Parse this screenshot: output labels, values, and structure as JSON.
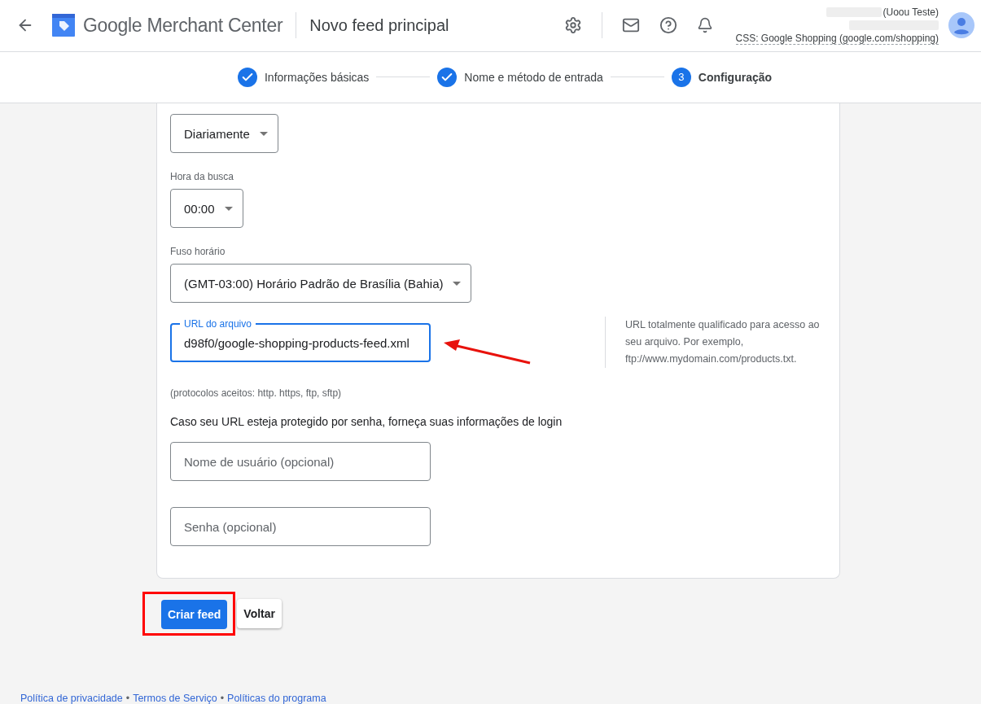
{
  "header": {
    "brand": "Google Merchant Center",
    "page_title": "Novo feed principal",
    "account": {
      "name": "(Uoou Teste)",
      "css": "CSS: Google Shopping (google.com/shopping)"
    }
  },
  "steps": [
    {
      "label": "Informações básicas",
      "done": true,
      "selected": false
    },
    {
      "label": "Nome e método de entrada",
      "done": true,
      "selected": false
    },
    {
      "label": "Configuração",
      "number": "3",
      "done": false,
      "selected": true
    }
  ],
  "form": {
    "frequency": {
      "value": "Diariamente"
    },
    "time": {
      "label": "Hora da busca",
      "value": "00:00"
    },
    "timezone": {
      "label": "Fuso horário",
      "value": "(GMT-03:00) Horário Padrão de Brasília (Bahia)"
    },
    "url": {
      "label": "URL do arquivo",
      "value": "d98f0/google-shopping-products-feed.xml",
      "focused": true,
      "help": "URL totalmente qualificado para acesso ao seu arquivo. Por exemplo, ftp://www.mydomain.com/products.txt."
    },
    "protocols_note": "(protocolos aceitos: http. https, ftp, sftp)",
    "login_prompt": "Caso seu URL esteja protegido por senha, forneça suas informações de login",
    "username": {
      "placeholder": "Nome de usuário (opcional)"
    },
    "password": {
      "placeholder": "Senha (opcional)"
    }
  },
  "buttons": [
    {
      "label": "Criar feed",
      "kind": "primary",
      "highlighted": true
    },
    {
      "label": "Voltar",
      "kind": "secondary",
      "highlighted": false
    }
  ],
  "footer": [
    {
      "kind": "link",
      "text": "Política de privacidade"
    },
    {
      "kind": "separator",
      "text": "•"
    },
    {
      "kind": "link",
      "text": "Termos de Serviço"
    },
    {
      "kind": "separator",
      "text": "•"
    },
    {
      "kind": "link",
      "text": "Políticas do programa"
    }
  ]
}
